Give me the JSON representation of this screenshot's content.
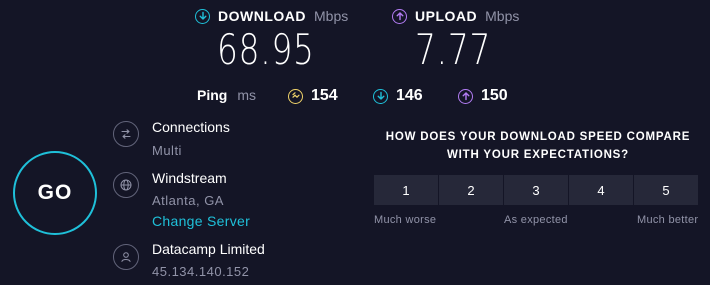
{
  "download": {
    "label": "DOWNLOAD",
    "unit": "Mbps",
    "value": "68.95",
    "icon": "download-arrow-icon",
    "color": "#1fc0d9"
  },
  "upload": {
    "label": "UPLOAD",
    "unit": "Mbps",
    "value": "7.77",
    "icon": "upload-arrow-icon",
    "color": "#b27cf3"
  },
  "ping": {
    "label": "Ping",
    "unit": "ms",
    "idle": {
      "value": "154",
      "icon": "ping-idle-icon",
      "color": "#f0d36a"
    },
    "download": {
      "value": "146",
      "icon": "ping-download-icon",
      "color": "#1fc0d9"
    },
    "upload": {
      "value": "150",
      "icon": "ping-upload-icon",
      "color": "#b27cf3"
    }
  },
  "go_button": {
    "label": "GO"
  },
  "connections": {
    "title": "Connections",
    "value": "Multi",
    "icon": "connections-icon"
  },
  "isp": {
    "name": "Windstream",
    "location": "Atlanta, GA",
    "change_link": "Change Server",
    "icon": "globe-icon"
  },
  "host": {
    "name": "Datacamp Limited",
    "ip": "45.134.140.152",
    "icon": "user-icon"
  },
  "survey": {
    "question_line1": "HOW DOES YOUR DOWNLOAD SPEED COMPARE",
    "question_line2": "WITH YOUR EXPECTATIONS?",
    "options": [
      "1",
      "2",
      "3",
      "4",
      "5"
    ],
    "label_low": "Much worse",
    "label_mid": "As expected",
    "label_high": "Much better"
  }
}
